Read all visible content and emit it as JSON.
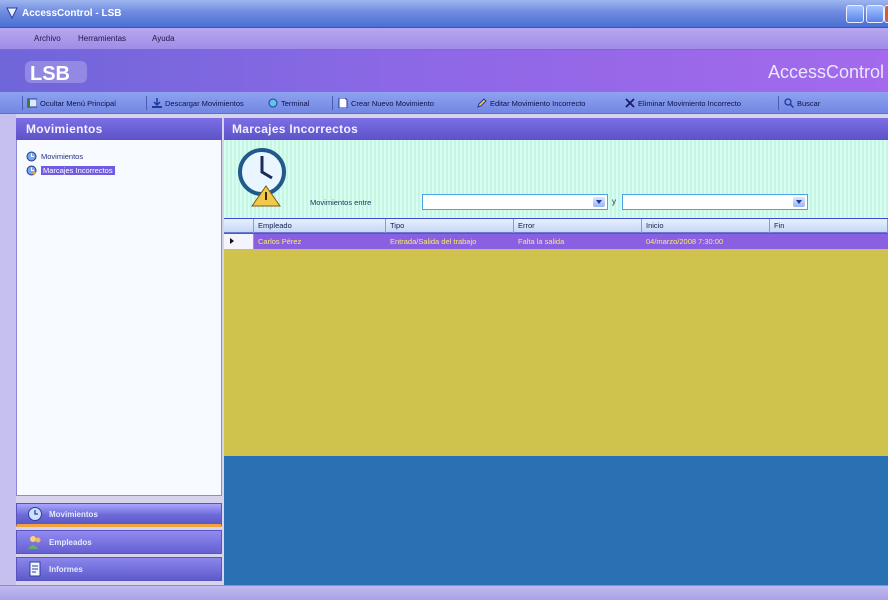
{
  "window": {
    "title": "AccessControl - LSB"
  },
  "menu": [
    "Archivo",
    "Herramientas",
    "Ayuda"
  ],
  "banner": {
    "logo_text": "LSB",
    "brand": "AccessControl"
  },
  "toolbar": [
    {
      "label": "Ocultar Menú Principal",
      "icon": "hide-menu-icon"
    },
    {
      "label": "Descargar Movimientos",
      "icon": "download-icon"
    },
    {
      "label": "Terminal",
      "icon": "terminal-icon"
    },
    {
      "label": "Crear Nuevo Movimiento",
      "icon": "new-document-icon"
    },
    {
      "label": "Editar Movimiento Incorrecto",
      "icon": "edit-icon"
    },
    {
      "label": "Eliminar Movimiento Incorrecto",
      "icon": "delete-icon"
    },
    {
      "label": "Buscar",
      "icon": "search-icon"
    }
  ],
  "left_panel": {
    "title": "Movimientos",
    "tree": [
      {
        "label": "Movimientos",
        "icon": "movements-icon",
        "selected": false
      },
      {
        "label": "Marcajes Incorrectos",
        "icon": "incorrect-marks-icon",
        "selected": true
      }
    ],
    "nav": [
      {
        "label": "Movimientos",
        "icon": "movements-icon",
        "active": true
      },
      {
        "label": "Empleados",
        "icon": "employees-icon",
        "active": false
      },
      {
        "label": "Informes",
        "icon": "reports-icon",
        "active": false
      }
    ]
  },
  "main": {
    "title": "Marcajes Incorrectos",
    "filter": {
      "label": "Movimientos entre",
      "separator": "y",
      "from_value": "",
      "to_value": ""
    },
    "grid": {
      "columns": [
        "Empleado",
        "Tipo",
        "Error",
        "Inicio",
        "Fin"
      ],
      "rows": [
        {
          "empleado": "Carlos Pérez",
          "tipo": "Entrada/Salida del trabajo",
          "error": "Falta la salida",
          "inicio": "04/marzo/2008 7:30:00",
          "fin": ""
        }
      ]
    }
  },
  "colors": {
    "header": "#6a5fd6",
    "row_selected": "#8a5fe2",
    "grid_empty_top": "#cfc34e",
    "grid_empty_bottom": "#2a71b3"
  }
}
